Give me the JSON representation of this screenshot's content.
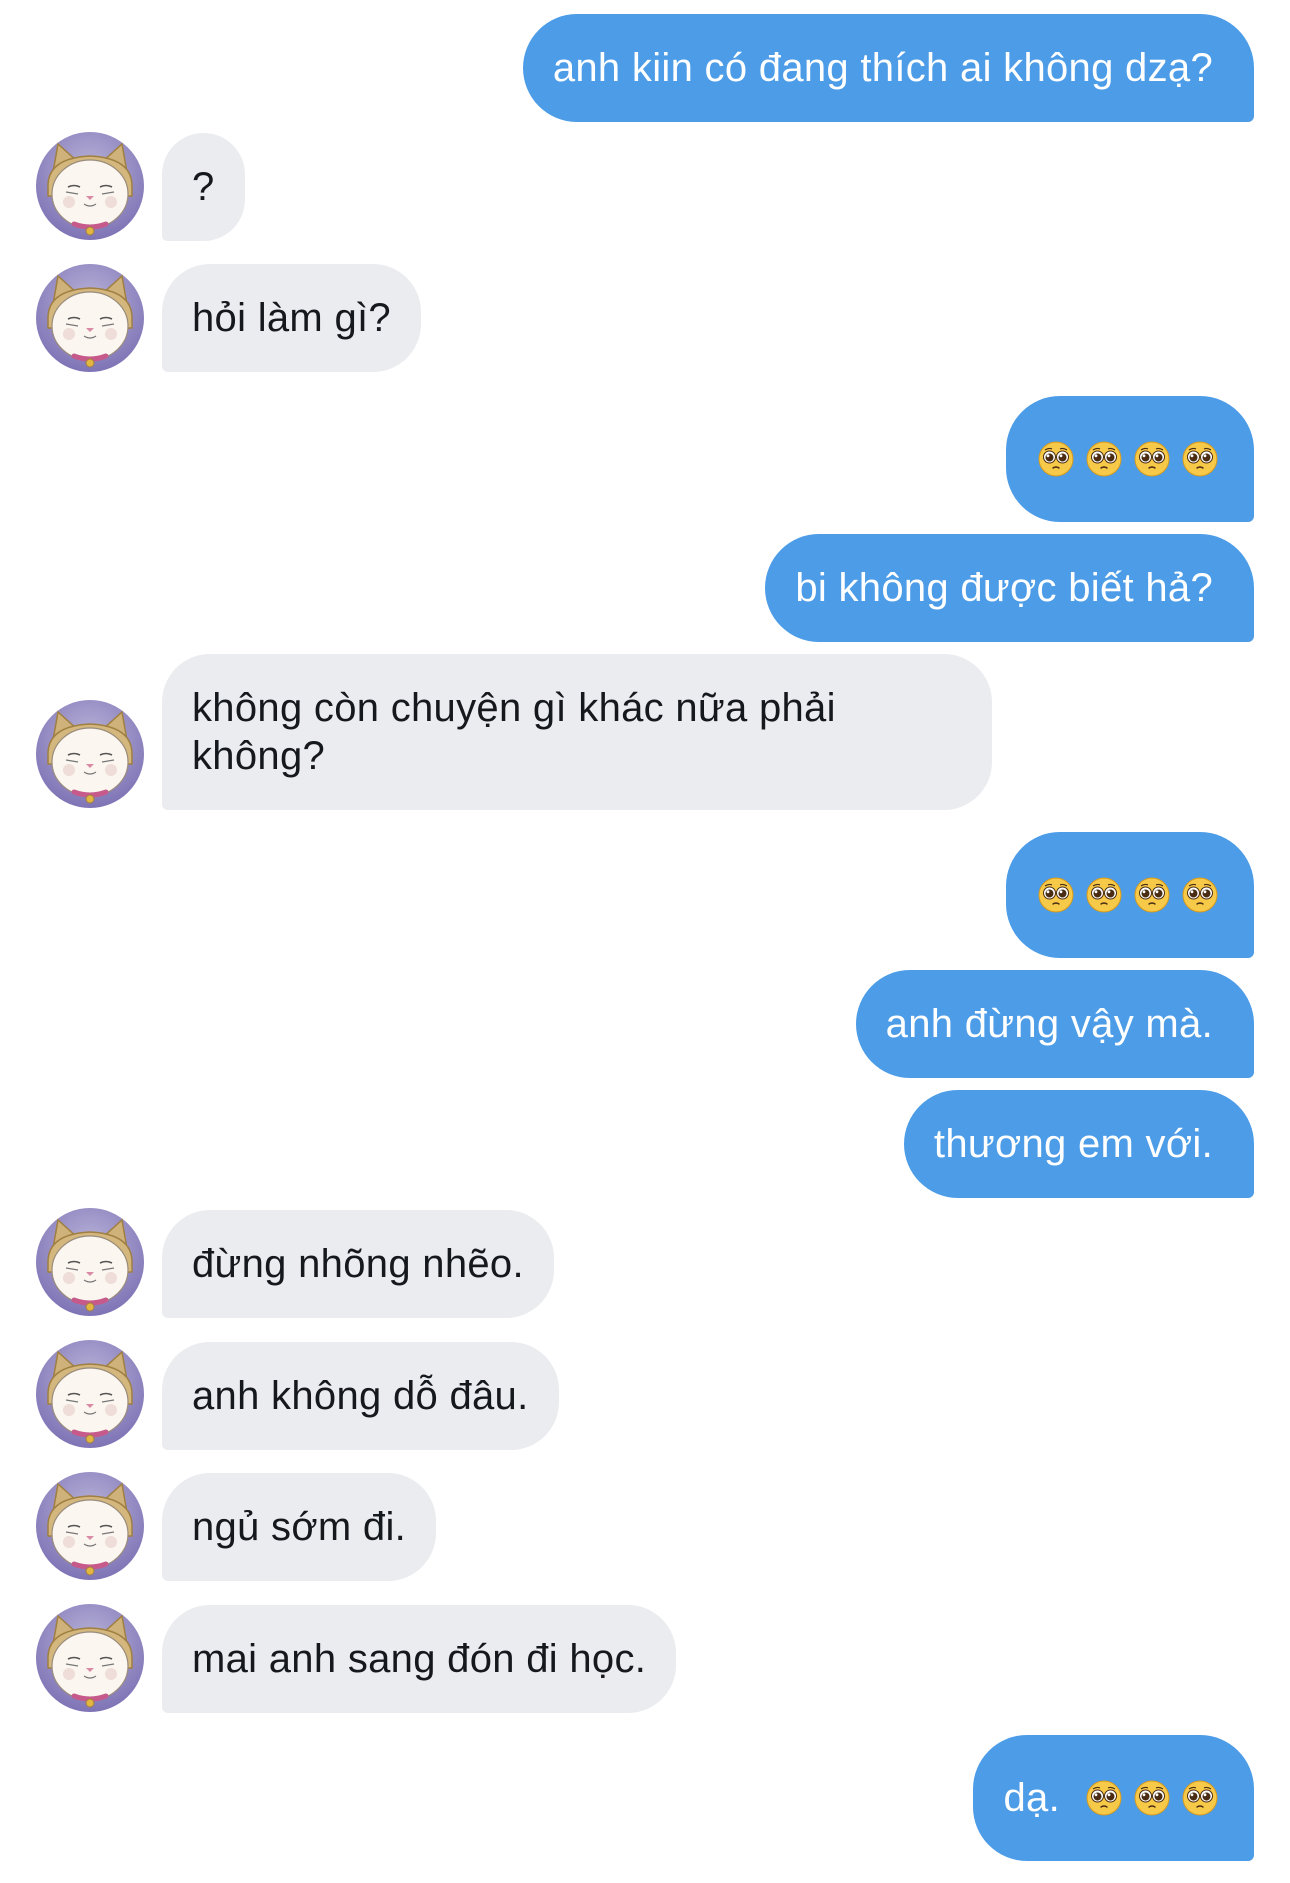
{
  "messages": [
    {
      "side": "out",
      "text": "anh kiin có đang thích ai không dzạ?"
    },
    {
      "side": "in",
      "text": "?"
    },
    {
      "side": "in",
      "text": "hỏi làm gì?"
    },
    {
      "side": "out",
      "emoji": [
        "pleading-face",
        "pleading-face",
        "pleading-face",
        "pleading-face"
      ]
    },
    {
      "side": "out",
      "text": "bi không được biết hả?"
    },
    {
      "side": "in",
      "text_lines": [
        "không còn chuyện gì khác nữa phải",
        "không?"
      ]
    },
    {
      "side": "out",
      "emoji": [
        "pleading-face",
        "pleading-face",
        "pleading-face",
        "pleading-face"
      ]
    },
    {
      "side": "out",
      "text": "anh đừng vậy mà."
    },
    {
      "side": "out",
      "text": "thương em với."
    },
    {
      "side": "in",
      "text": "đừng nhõng nhẽo."
    },
    {
      "side": "in",
      "text": "anh không dỗ đâu."
    },
    {
      "side": "in",
      "text": "ngủ sớm đi."
    },
    {
      "side": "in",
      "text": "mai anh sang đón đi học."
    },
    {
      "side": "out",
      "text": "dạ.",
      "emoji": [
        "pleading-face",
        "pleading-face",
        "pleading-face"
      ]
    }
  ],
  "colors": {
    "outgoing_bubble": "#4c9ce8",
    "incoming_bubble": "#eaecef",
    "outgoing_text": "#ffffff",
    "incoming_text": "#15181d"
  },
  "icons": {
    "avatar": "cat-avatar",
    "emoji": "pleading-face-emoji"
  }
}
